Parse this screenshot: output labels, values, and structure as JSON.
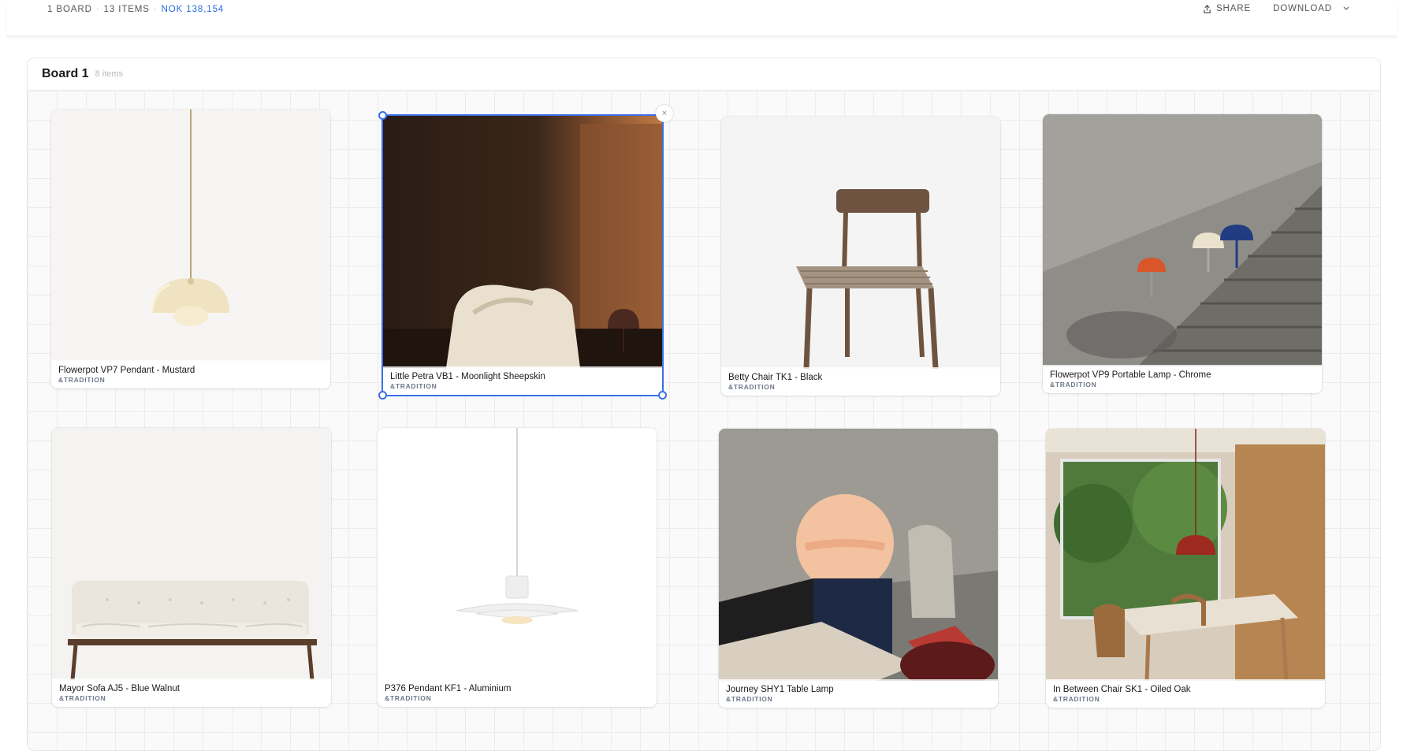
{
  "summary": {
    "boards": "1 BOARD",
    "items": "13 ITEMS",
    "total": "NOK 138,154",
    "separator": "·"
  },
  "actions": {
    "share_label": "SHARE",
    "download_label": "DOWNLOAD"
  },
  "board": {
    "title": "Board 1",
    "count": "8 items"
  },
  "cards": [
    {
      "name": "Flowerpot VP7 Pendant - Mustard",
      "brand": "&TRADITION"
    },
    {
      "name": "Little Petra VB1 - Moonlight Sheepskin",
      "brand": "&TRADITION"
    },
    {
      "name": "Betty Chair TK1 - Black",
      "brand": "&TRADITION"
    },
    {
      "name": "Flowerpot VP9 Portable Lamp - Chrome",
      "brand": "&TRADITION"
    },
    {
      "name": "Mayor Sofa AJ5 - Blue Walnut",
      "brand": "&TRADITION"
    },
    {
      "name": "P376 Pendant KF1 - Aluminium",
      "brand": "&TRADITION"
    },
    {
      "name": "Journey SHY1 Table Lamp",
      "brand": "&TRADITION"
    },
    {
      "name": "In Between Chair SK1 - Oiled Oak",
      "brand": "&TRADITION"
    }
  ],
  "close_glyph": "×",
  "colors": {
    "accent": "#3b6fe6",
    "price": "#2c6be0",
    "brand": "#6d7889"
  }
}
